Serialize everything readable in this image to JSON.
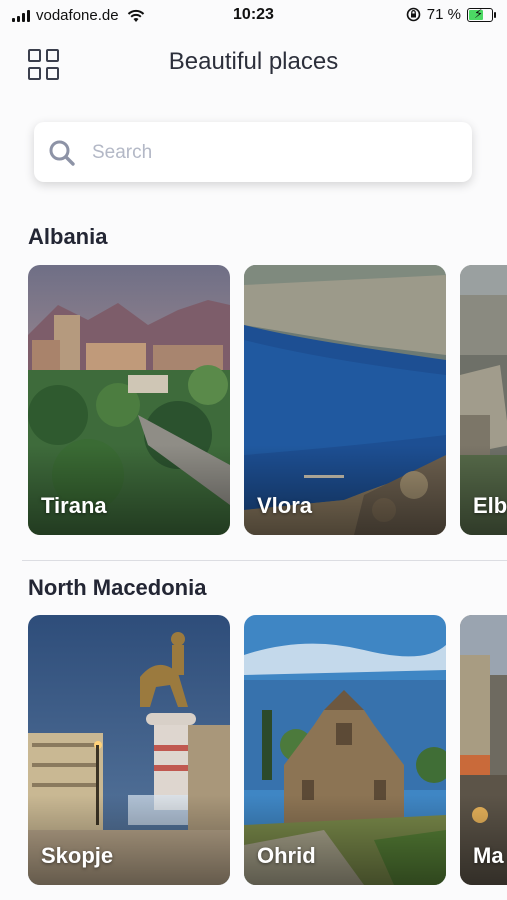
{
  "status_bar": {
    "carrier": "vodafone.de",
    "time": "10:23",
    "battery_text": "71 %",
    "battery_level": 0.71
  },
  "header": {
    "title": "Beautiful places",
    "menu_icon": "grid-icon"
  },
  "search": {
    "placeholder": "Search",
    "icon": "search-icon"
  },
  "sections": [
    {
      "title": "Albania",
      "cities": [
        {
          "name": "Tirana"
        },
        {
          "name": "Vlora"
        },
        {
          "name": "Elb"
        }
      ]
    },
    {
      "title": "North Macedonia",
      "cities": [
        {
          "name": "Skopje"
        },
        {
          "name": "Ohrid"
        },
        {
          "name": "Ma"
        }
      ]
    }
  ],
  "colors": {
    "background": "#fbfbfc",
    "text": "#232634",
    "placeholder": "#b3b8c6",
    "battery_fill": "#4cd964"
  }
}
